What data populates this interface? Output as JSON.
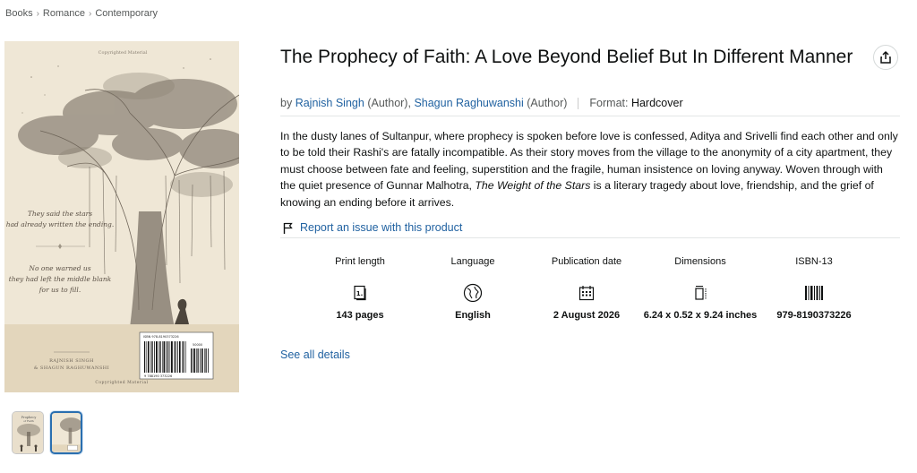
{
  "breadcrumb": {
    "items": [
      "Books",
      "Romance",
      "Contemporary"
    ],
    "separator": "›"
  },
  "cover": {
    "top_caption": "Copyrighted Material",
    "quote_lines": [
      "They said the stars",
      "had already written the ending."
    ],
    "quote2_lines": [
      "No one warned us",
      "they had left the middle blank",
      "for us to fill."
    ],
    "authors_lines": [
      "RAJNISH SINGH",
      "& SHAGUN RAGHUWANSHI"
    ],
    "bottom_caption": "Copyrighted Material",
    "barcode_top": "ISBN 978-8190373226",
    "barcode_price": "50000",
    "barcode_number": "9 788190 373226"
  },
  "thumbnails": [
    {
      "label": "Prophecy of Faith",
      "active": false
    },
    {
      "label": "Back cover",
      "active": true
    }
  ],
  "product": {
    "title": "The Prophecy of Faith: A Love Beyond Belief But In Different Manner",
    "by_label": "by",
    "authors": [
      {
        "name": "Rajnish Singh",
        "role": "(Author),"
      },
      {
        "name": "Shagun Raghuwanshi",
        "role": "(Author)"
      }
    ],
    "format_label": "Format:",
    "format_value": "Hardcover",
    "description_before": "In the dusty lanes of Sultanpur, where prophecy is spoken before love is confessed, Aditya and Srivelli find each other and only to be told their Rashi's are fatally incompatible. As their story moves from the village to the anonymity of a city apartment, they must choose between fate and feeling, superstition and the fragile, human insistence on loving anyway. Woven through with the quiet presence of Gunnar Malhotra, ",
    "description_italic": "The Weight of the Stars",
    "description_after": " is a literary tragedy about love, friendship, and the grief of knowing an ending before it arrives.",
    "report_link": "Report an issue with this product",
    "see_all": "See all details"
  },
  "details": [
    {
      "label": "Print length",
      "icon": "book-pages-icon",
      "value": "143 pages"
    },
    {
      "label": "Language",
      "icon": "globe-icon",
      "value": "English"
    },
    {
      "label": "Publication date",
      "icon": "calendar-icon",
      "value": "2 August 2026"
    },
    {
      "label": "Dimensions",
      "icon": "dimensions-icon",
      "value": "6.24 x 0.52 x 9.24 inches"
    },
    {
      "label": "ISBN-13",
      "icon": "barcode-icon",
      "value": "979-8190373226"
    }
  ],
  "colors": {
    "link": "#2162a1",
    "text": "#0f1111",
    "muted": "#565959",
    "cover_background": "#eee4d2"
  }
}
